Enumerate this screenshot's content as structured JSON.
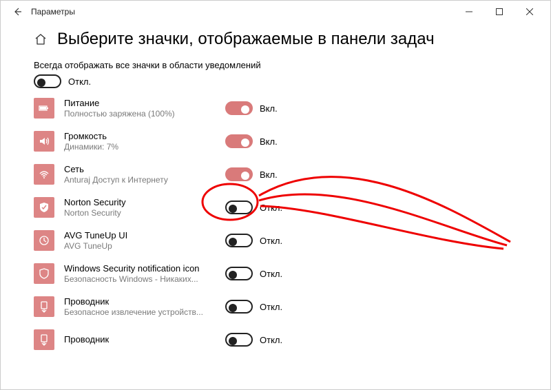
{
  "window": {
    "title": "Параметры"
  },
  "page": {
    "title": "Выберите значки, отображаемые в панели задач"
  },
  "always_show": {
    "text": "Всегда отображать все значки в области уведомлений",
    "state": false,
    "label": "Откл."
  },
  "labels": {
    "on": "Вкл.",
    "off": "Откл."
  },
  "items": [
    {
      "icon": "battery-icon",
      "title": "Питание",
      "sub": "Полностью заряжена (100%)",
      "on": true
    },
    {
      "icon": "volume-icon",
      "title": "Громкость",
      "sub": "Динамики: 7%",
      "on": true
    },
    {
      "icon": "wifi-icon",
      "title": "Сеть",
      "sub": "Anturaj Доступ к Интернету",
      "on": true
    },
    {
      "icon": "shield-icon",
      "title": "Norton Security",
      "sub": "Norton Security",
      "on": false
    },
    {
      "icon": "tuneup-icon",
      "title": "AVG TuneUp UI",
      "sub": "AVG TuneUp",
      "on": false
    },
    {
      "icon": "security-icon",
      "title": "Windows Security notification icon",
      "sub": "Безопасность Windows - Никаких...",
      "on": false
    },
    {
      "icon": "explorer-icon",
      "title": "Проводник",
      "sub": "Безопасное извлечение устройств...",
      "on": false
    },
    {
      "icon": "explorer-icon",
      "title": "Проводник",
      "sub": "",
      "on": false
    }
  ]
}
